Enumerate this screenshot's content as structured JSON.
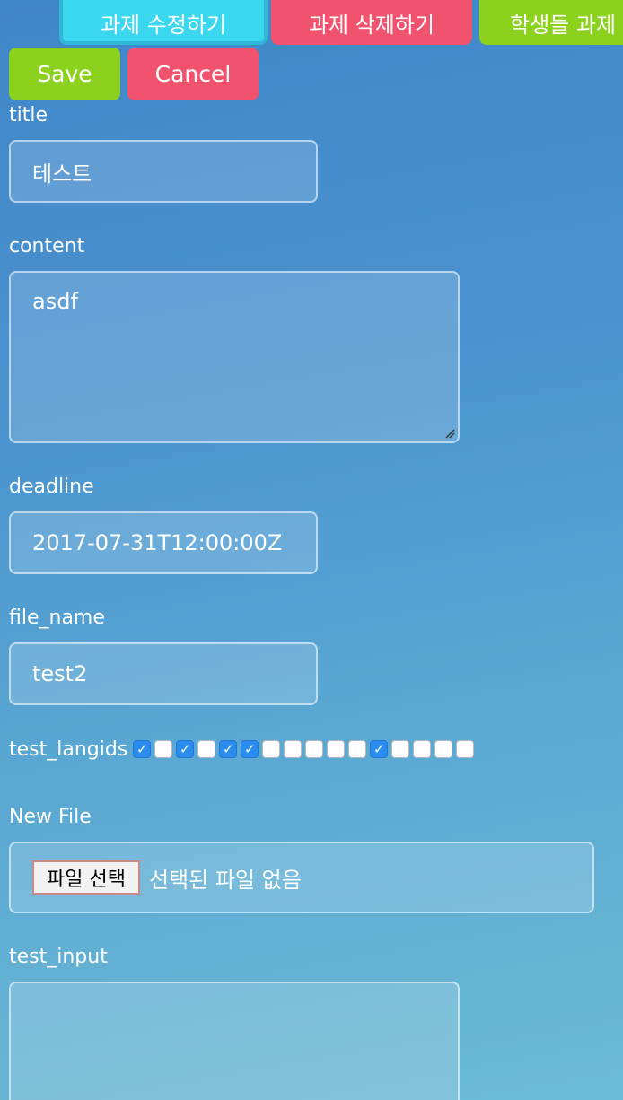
{
  "topnav": {
    "edit_label": "과제 수정하기",
    "delete_label": "과제 삭제하기",
    "students_label": "학생들 과제"
  },
  "actions": {
    "save_label": "Save",
    "cancel_label": "Cancel"
  },
  "form": {
    "title": {
      "label": "title",
      "value": "테스트"
    },
    "content": {
      "label": "content",
      "value": "asdf"
    },
    "deadline": {
      "label": "deadline",
      "value": "2017-07-31T12:00:00Z"
    },
    "file_name": {
      "label": "file_name",
      "value": "test2"
    },
    "test_langids": {
      "label": "test_langids",
      "checked": [
        true,
        false,
        true,
        false,
        true,
        true,
        false,
        false,
        false,
        false,
        false,
        true,
        false,
        false,
        false,
        false
      ]
    },
    "new_file": {
      "label": "New File",
      "button_label": "파일 선택",
      "status": "선택된 파일 없음"
    },
    "test_input": {
      "label": "test_input",
      "value": ""
    }
  },
  "colors": {
    "nav_edit": "#3ad7ee",
    "nav_delete": "#f1536e",
    "nav_students": "#8bd11d",
    "checkbox_checked": "#2b8cf0"
  }
}
